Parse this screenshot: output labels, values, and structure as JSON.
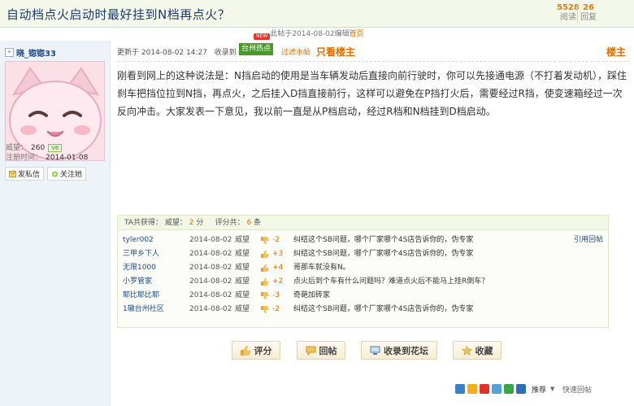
{
  "thread": {
    "title": "自动档点火启动时最好挂到N档再点火？",
    "views_count": "5528",
    "views_label": "阅读",
    "replies_count": "26",
    "replies_label": "回复"
  },
  "last_edit": {
    "text": "此帖于2014-08-02编辑",
    "who": "首页"
  },
  "author": {
    "username": "晓_锪锪33",
    "prestige_label": "威望：",
    "prestige_value": "260",
    "level_badge": "V6",
    "regdate_label": "注册时间：",
    "regdate_value": "2014-01-08",
    "msg_btn": "发私信",
    "follow_btn": "关注她"
  },
  "post_header": {
    "updated_label": "更新于",
    "updated_time": "2014-08-02 14:27",
    "collected_label": "收录到",
    "hot_tag": "台州热点",
    "new_badge": "NEW",
    "filter_water": "过滤水帖",
    "only_op": "只看楼主",
    "floor": "楼主"
  },
  "post_body": "刚看到网上的这种说法是：N挡启动的使用是当车辆发动后直接向前行驶时，你可以先接通电源（不打着发动机），踩住刹车把挡位拉到N挡，再点火，之后挂入D挡直接前行，这样可以避免在P挡打火后，需要经过R挡，使变速箱经过一次反向冲击。大家发表一下意见，我以前一直是从P档启动，经过R档和N档挂到D档启动。",
  "ratings": {
    "head_label": "TA共获得：",
    "prestige_label": "威望：",
    "prestige_total": "2",
    "prestige_unit": "分",
    "count_label": "评分共：",
    "count_total": "6",
    "count_unit": "条",
    "quote_reply": "引用回帖",
    "rows": [
      {
        "user": "tyler002",
        "date": "2014-08-02",
        "type": "威望",
        "sign": "down",
        "score": "-2",
        "comment": "纠结这个SB问题，哪个厂家哪个4S店告诉你的，伪专家"
      },
      {
        "user": "三甲乡下人",
        "date": "2014-08-02",
        "type": "威望",
        "sign": "up",
        "score": "+3",
        "comment": "纠结这个SB问题，哪个厂家哪个4S店告诉你的，伪专家"
      },
      {
        "user": "无限1000",
        "date": "2014-08-02",
        "type": "威望",
        "sign": "up",
        "score": "+4",
        "comment": "哥那车就没有N。"
      },
      {
        "user": "小罗管家",
        "date": "2014-08-02",
        "type": "威望",
        "sign": "up",
        "score": "+2",
        "comment": "点火后到个车有什么问题吗？难道点火后不能马上挂R倒车？"
      },
      {
        "user": "耶比耶比耶",
        "date": "2014-08-02",
        "type": "威望",
        "sign": "down",
        "score": "-3",
        "comment": "奇葩加砖家"
      },
      {
        "user": "1辙台州社区",
        "date": "2014-08-02",
        "type": "威望",
        "sign": "down",
        "score": "-2",
        "comment": "纠结这个SB问题，哪个厂家哪个4S店告诉你的，伪专家"
      }
    ]
  },
  "actions": {
    "rate": "评分",
    "reply": "回帖",
    "collect": "收录到花坛",
    "favorite": "收藏"
  },
  "share": {
    "recommend": "推荐",
    "recommend_arrow": "▼",
    "right_text": "快速回帖"
  },
  "colors": {
    "accent": "#e06c00",
    "link": "#1e4a8e",
    "title": "#1e3a6e",
    "header_bg": "#f3f8ea"
  }
}
